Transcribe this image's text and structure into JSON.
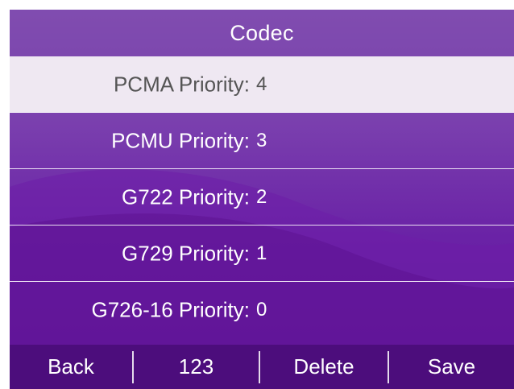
{
  "title": "Codec",
  "rows": [
    {
      "label": "PCMA Priority:",
      "value": "4",
      "selected": true
    },
    {
      "label": "PCMU Priority:",
      "value": "3"
    },
    {
      "label": "G722 Priority:",
      "value": "2"
    },
    {
      "label": "G729 Priority:",
      "value": "1"
    },
    {
      "label": "G726-16 Priority:",
      "value": "0"
    }
  ],
  "softkeys": {
    "back": "Back",
    "input_mode": "123",
    "delete": "Delete",
    "save": "Save"
  },
  "colors": {
    "background_top": "#8a55b8",
    "background_bottom": "#5c1596",
    "selected_row": "#efe8f2",
    "softkey_bar": "#4c0d7c"
  }
}
